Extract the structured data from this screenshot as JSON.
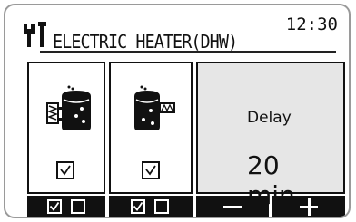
{
  "header": {
    "title": "ELECTRIC HEATER(DHW)",
    "time": "12:30",
    "icon": "wrench-screwdriver-icon"
  },
  "panels": [
    {
      "icon": "tank-with-heater-icon",
      "checked": true
    },
    {
      "icon": "tank-with-booster-heater-icon",
      "checked": true
    },
    {
      "label": "Delay",
      "value": "20",
      "unit": "min."
    }
  ],
  "softkeys": [
    {
      "icon": "checkbox-icon"
    },
    {
      "icon": "checkbox-icon"
    },
    {
      "icon": "minus-icon"
    },
    {
      "icon": "plus-icon"
    }
  ],
  "colors": {
    "ink": "#111111",
    "panel_bg": "#e6e6e6",
    "frame": "#9a9a9a"
  }
}
